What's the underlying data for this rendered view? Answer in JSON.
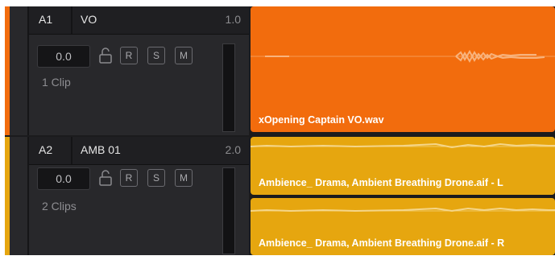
{
  "tracks": [
    {
      "id": "A1",
      "name": "VO",
      "level": "1.0",
      "volume": "0.0",
      "buttons": {
        "record": "R",
        "solo": "S",
        "mute": "M"
      },
      "clip_count": "1 Clip",
      "color": "#f26c0d",
      "clips": [
        {
          "label": "xOpening Captain VO.wav"
        }
      ]
    },
    {
      "id": "A2",
      "name": "AMB 01",
      "level": "2.0",
      "volume": "0.0",
      "buttons": {
        "record": "R",
        "solo": "S",
        "mute": "M"
      },
      "clip_count": "2 Clips",
      "color": "#e6a60f",
      "clips": [
        {
          "label": "Ambience_ Drama, Ambient Breathing Drone.aif - L"
        },
        {
          "label": "Ambience_ Drama, Ambient Breathing Drone.aif - R"
        }
      ]
    }
  ]
}
